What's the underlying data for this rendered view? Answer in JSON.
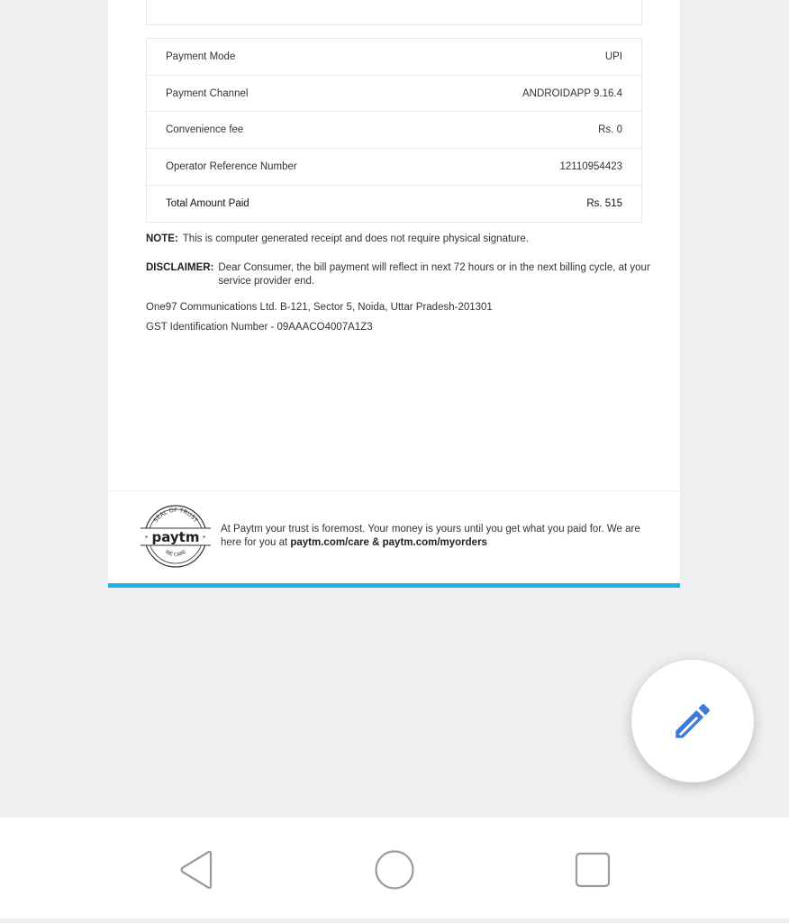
{
  "receipt": {
    "rows": [
      {
        "label": "Payment Mode",
        "value": "UPI"
      },
      {
        "label": "Payment Channel",
        "value": "ANDROIDAPP 9.16.4"
      },
      {
        "label": "Convenience fee",
        "value": "Rs. 0"
      },
      {
        "label": "Operator Reference Number",
        "value": "12110954423"
      },
      {
        "label": "Total Amount Paid",
        "value": "Rs. 515"
      }
    ],
    "note_label": "NOTE:",
    "note_text": "This is computer generated receipt and does not require physical signature.",
    "disclaimer_label": "DISCLAIMER:",
    "disclaimer_text": "Dear Consumer, the bill payment will reflect in next 72 hours or in the next billing cycle, at your service provider end.",
    "address": "One97 Communications Ltd. B-121, Sector 5, Noida, Uttar Pradesh-201301",
    "gst": "GST Identification Number - 09AAACO4007A1Z3"
  },
  "footer": {
    "seal_top_text": "SEAL OF TRUST",
    "seal_brand": "paytm",
    "seal_bottom_text": "WE CARE",
    "trust_text": "At Paytm your trust is foremost. Your money is yours until you get what you paid for. We are here for you at",
    "links_text": "paytm.com/care & paytm.com/myorders"
  },
  "fab": {
    "icon": "pencil-icon",
    "color": "#3a7bd5"
  },
  "navbar": {
    "back_icon": "back-icon",
    "home_icon": "home-icon",
    "recents_icon": "recents-icon"
  },
  "colors": {
    "accent_bar": "#1fb3e5",
    "background": "#eeeff1"
  }
}
